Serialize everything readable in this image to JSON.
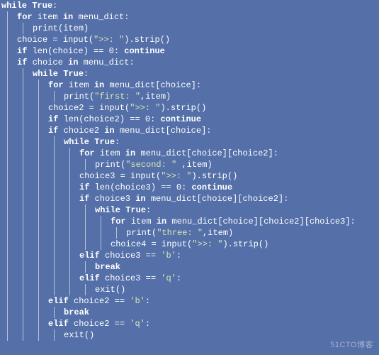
{
  "watermark": "51CTO博客",
  "code": {
    "lines": [
      {
        "indent": 0,
        "guides": [],
        "tokens": [
          [
            "kw",
            "while"
          ],
          [
            "punc",
            " "
          ],
          [
            "kw",
            "True"
          ],
          [
            "punc",
            ":"
          ]
        ]
      },
      {
        "indent": 1,
        "guides": [
          0
        ],
        "tokens": [
          [
            "kw",
            "for"
          ],
          [
            "punc",
            " "
          ],
          [
            "ident",
            "item"
          ],
          [
            "punc",
            " "
          ],
          [
            "kw",
            "in"
          ],
          [
            "punc",
            " "
          ],
          [
            "ident",
            "menu_dict"
          ],
          [
            "punc",
            ":"
          ]
        ]
      },
      {
        "indent": 2,
        "guides": [
          0,
          1
        ],
        "tokens": [
          [
            "ident",
            "print"
          ],
          [
            "punc",
            "("
          ],
          [
            "ident",
            "item"
          ],
          [
            "punc",
            ")"
          ]
        ]
      },
      {
        "indent": 1,
        "guides": [
          0
        ],
        "tokens": [
          [
            "ident",
            "choice"
          ],
          [
            "punc",
            " = "
          ],
          [
            "ident",
            "input"
          ],
          [
            "punc",
            "("
          ],
          [
            "str",
            "\">>: \""
          ],
          [
            "punc",
            ")."
          ],
          [
            "ident",
            "strip"
          ],
          [
            "punc",
            "()"
          ]
        ]
      },
      {
        "indent": 1,
        "guides": [
          0
        ],
        "tokens": [
          [
            "kw",
            "if"
          ],
          [
            "punc",
            " "
          ],
          [
            "ident",
            "len"
          ],
          [
            "punc",
            "("
          ],
          [
            "ident",
            "choice"
          ],
          [
            "punc",
            ") == "
          ],
          [
            "num",
            "0"
          ],
          [
            "punc",
            ": "
          ],
          [
            "kw",
            "continue"
          ]
        ]
      },
      {
        "indent": 1,
        "guides": [
          0
        ],
        "tokens": [
          [
            "kw",
            "if"
          ],
          [
            "punc",
            " "
          ],
          [
            "ident",
            "choice"
          ],
          [
            "punc",
            " "
          ],
          [
            "kw",
            "in"
          ],
          [
            "punc",
            " "
          ],
          [
            "ident",
            "menu_dict"
          ],
          [
            "punc",
            ":"
          ]
        ]
      },
      {
        "indent": 2,
        "guides": [
          0,
          1
        ],
        "tokens": [
          [
            "kw",
            "while"
          ],
          [
            "punc",
            " "
          ],
          [
            "kw",
            "True"
          ],
          [
            "punc",
            ":"
          ]
        ]
      },
      {
        "indent": 3,
        "guides": [
          0,
          1,
          2
        ],
        "tokens": [
          [
            "kw",
            "for"
          ],
          [
            "punc",
            " "
          ],
          [
            "ident",
            "item"
          ],
          [
            "punc",
            " "
          ],
          [
            "kw",
            "in"
          ],
          [
            "punc",
            " "
          ],
          [
            "ident",
            "menu_dict"
          ],
          [
            "punc",
            "["
          ],
          [
            "ident",
            "choice"
          ],
          [
            "punc",
            "]:"
          ]
        ]
      },
      {
        "indent": 4,
        "guides": [
          0,
          1,
          2,
          3
        ],
        "tokens": [
          [
            "ident",
            "print"
          ],
          [
            "punc",
            "("
          ],
          [
            "str",
            "\"first: \""
          ],
          [
            "punc",
            ","
          ],
          [
            "ident",
            "item"
          ],
          [
            "punc",
            ")"
          ]
        ]
      },
      {
        "indent": 3,
        "guides": [
          0,
          1,
          2
        ],
        "tokens": [
          [
            "ident",
            "choice2"
          ],
          [
            "punc",
            " = "
          ],
          [
            "ident",
            "input"
          ],
          [
            "punc",
            "("
          ],
          [
            "str",
            "\">>: \""
          ],
          [
            "punc",
            ")."
          ],
          [
            "ident",
            "strip"
          ],
          [
            "punc",
            "()"
          ]
        ]
      },
      {
        "indent": 3,
        "guides": [
          0,
          1,
          2
        ],
        "tokens": [
          [
            "kw",
            "if"
          ],
          [
            "punc",
            " "
          ],
          [
            "ident",
            "len"
          ],
          [
            "punc",
            "("
          ],
          [
            "ident",
            "choice2"
          ],
          [
            "punc",
            ") == "
          ],
          [
            "num",
            "0"
          ],
          [
            "punc",
            ": "
          ],
          [
            "kw",
            "continue"
          ]
        ]
      },
      {
        "indent": 3,
        "guides": [
          0,
          1,
          2
        ],
        "tokens": [
          [
            "kw",
            "if"
          ],
          [
            "punc",
            " "
          ],
          [
            "ident",
            "choice2"
          ],
          [
            "punc",
            " "
          ],
          [
            "kw",
            "in"
          ],
          [
            "punc",
            " "
          ],
          [
            "ident",
            "menu_dict"
          ],
          [
            "punc",
            "["
          ],
          [
            "ident",
            "choice"
          ],
          [
            "punc",
            "]:"
          ]
        ]
      },
      {
        "indent": 4,
        "guides": [
          0,
          1,
          2,
          3
        ],
        "tokens": [
          [
            "kw",
            "while"
          ],
          [
            "punc",
            " "
          ],
          [
            "kw",
            "True"
          ],
          [
            "punc",
            ":"
          ]
        ]
      },
      {
        "indent": 5,
        "guides": [
          0,
          1,
          2,
          3,
          4
        ],
        "tokens": [
          [
            "kw",
            "for"
          ],
          [
            "punc",
            " "
          ],
          [
            "ident",
            "item"
          ],
          [
            "punc",
            " "
          ],
          [
            "kw",
            "in"
          ],
          [
            "punc",
            " "
          ],
          [
            "ident",
            "menu_dict"
          ],
          [
            "punc",
            "["
          ],
          [
            "ident",
            "choice"
          ],
          [
            "punc",
            "]["
          ],
          [
            "ident",
            "choice2"
          ],
          [
            "punc",
            "]:"
          ]
        ]
      },
      {
        "indent": 6,
        "guides": [
          0,
          1,
          2,
          3,
          4,
          5
        ],
        "tokens": [
          [
            "ident",
            "print"
          ],
          [
            "punc",
            "("
          ],
          [
            "str",
            "\"second: \""
          ],
          [
            "punc",
            " ,"
          ],
          [
            "ident",
            "item"
          ],
          [
            "punc",
            ")"
          ]
        ]
      },
      {
        "indent": 5,
        "guides": [
          0,
          1,
          2,
          3,
          4
        ],
        "tokens": [
          [
            "ident",
            "choice3"
          ],
          [
            "punc",
            " = "
          ],
          [
            "ident",
            "input"
          ],
          [
            "punc",
            "("
          ],
          [
            "str",
            "\">>: \""
          ],
          [
            "punc",
            ")."
          ],
          [
            "ident",
            "strip"
          ],
          [
            "punc",
            "()"
          ]
        ]
      },
      {
        "indent": 5,
        "guides": [
          0,
          1,
          2,
          3,
          4
        ],
        "tokens": [
          [
            "kw",
            "if"
          ],
          [
            "punc",
            " "
          ],
          [
            "ident",
            "len"
          ],
          [
            "punc",
            "("
          ],
          [
            "ident",
            "choice3"
          ],
          [
            "punc",
            ") == "
          ],
          [
            "num",
            "0"
          ],
          [
            "punc",
            ": "
          ],
          [
            "kw",
            "continue"
          ]
        ]
      },
      {
        "indent": 5,
        "guides": [
          0,
          1,
          2,
          3,
          4
        ],
        "tokens": [
          [
            "kw",
            "if"
          ],
          [
            "punc",
            " "
          ],
          [
            "ident",
            "choice3"
          ],
          [
            "punc",
            " "
          ],
          [
            "kw",
            "in"
          ],
          [
            "punc",
            " "
          ],
          [
            "ident",
            "menu_dict"
          ],
          [
            "punc",
            "["
          ],
          [
            "ident",
            "choice"
          ],
          [
            "punc",
            "]["
          ],
          [
            "ident",
            "choice2"
          ],
          [
            "punc",
            "]:"
          ]
        ]
      },
      {
        "indent": 6,
        "guides": [
          0,
          1,
          2,
          3,
          4,
          5
        ],
        "tokens": [
          [
            "kw",
            "while"
          ],
          [
            "punc",
            " "
          ],
          [
            "kw",
            "True"
          ],
          [
            "punc",
            ":"
          ]
        ]
      },
      {
        "indent": 7,
        "guides": [
          0,
          1,
          2,
          3,
          4,
          5,
          6
        ],
        "tokens": [
          [
            "kw",
            "for"
          ],
          [
            "punc",
            " "
          ],
          [
            "ident",
            "item"
          ],
          [
            "punc",
            " "
          ],
          [
            "kw",
            "in"
          ],
          [
            "punc",
            " "
          ],
          [
            "ident",
            "menu_dict"
          ],
          [
            "punc",
            "["
          ],
          [
            "ident",
            "choice"
          ],
          [
            "punc",
            "]["
          ],
          [
            "ident",
            "choice2"
          ],
          [
            "punc",
            "]["
          ],
          [
            "ident",
            "choice3"
          ],
          [
            "punc",
            "]:"
          ]
        ]
      },
      {
        "indent": 8,
        "guides": [
          0,
          1,
          2,
          3,
          4,
          5,
          6,
          7
        ],
        "tokens": [
          [
            "ident",
            "print"
          ],
          [
            "punc",
            "("
          ],
          [
            "str",
            "\"three: \""
          ],
          [
            "punc",
            ","
          ],
          [
            "ident",
            "item"
          ],
          [
            "punc",
            ")"
          ]
        ]
      },
      {
        "indent": 7,
        "guides": [
          0,
          1,
          2,
          3,
          4,
          5,
          6
        ],
        "tokens": [
          [
            "ident",
            "choice4"
          ],
          [
            "punc",
            " = "
          ],
          [
            "ident",
            "input"
          ],
          [
            "punc",
            "("
          ],
          [
            "str",
            "\">>: \""
          ],
          [
            "punc",
            ")."
          ],
          [
            "ident",
            "strip"
          ],
          [
            "punc",
            "()"
          ]
        ]
      },
      {
        "indent": 5,
        "guides": [
          0,
          1,
          2,
          3,
          4
        ],
        "tokens": [
          [
            "kw",
            "elif"
          ],
          [
            "punc",
            " "
          ],
          [
            "ident",
            "choice3"
          ],
          [
            "punc",
            " == "
          ],
          [
            "str",
            "'b'"
          ],
          [
            "punc",
            ":"
          ]
        ]
      },
      {
        "indent": 6,
        "guides": [
          0,
          1,
          2,
          3,
          4,
          5
        ],
        "tokens": [
          [
            "kw",
            "break"
          ]
        ]
      },
      {
        "indent": 5,
        "guides": [
          0,
          1,
          2,
          3,
          4
        ],
        "tokens": [
          [
            "kw",
            "elif"
          ],
          [
            "punc",
            " "
          ],
          [
            "ident",
            "choice3"
          ],
          [
            "punc",
            " == "
          ],
          [
            "str",
            "'q'"
          ],
          [
            "punc",
            ":"
          ]
        ]
      },
      {
        "indent": 6,
        "guides": [
          0,
          1,
          2,
          3,
          4,
          5
        ],
        "tokens": [
          [
            "ident",
            "exit"
          ],
          [
            "punc",
            "()"
          ]
        ]
      },
      {
        "indent": 3,
        "guides": [
          0,
          1,
          2
        ],
        "tokens": [
          [
            "kw",
            "elif"
          ],
          [
            "punc",
            " "
          ],
          [
            "ident",
            "choice2"
          ],
          [
            "punc",
            " == "
          ],
          [
            "str",
            "'b'"
          ],
          [
            "punc",
            ":"
          ]
        ]
      },
      {
        "indent": 4,
        "guides": [
          0,
          1,
          2,
          3
        ],
        "tokens": [
          [
            "kw",
            "break"
          ]
        ]
      },
      {
        "indent": 3,
        "guides": [
          0,
          1,
          2
        ],
        "tokens": [
          [
            "kw",
            "elif"
          ],
          [
            "punc",
            " "
          ],
          [
            "ident",
            "choice2"
          ],
          [
            "punc",
            " == "
          ],
          [
            "str",
            "'q'"
          ],
          [
            "punc",
            ":"
          ]
        ]
      },
      {
        "indent": 4,
        "guides": [
          0,
          1,
          2,
          3
        ],
        "tokens": [
          [
            "ident",
            "exit"
          ],
          [
            "punc",
            "()"
          ]
        ]
      }
    ]
  }
}
